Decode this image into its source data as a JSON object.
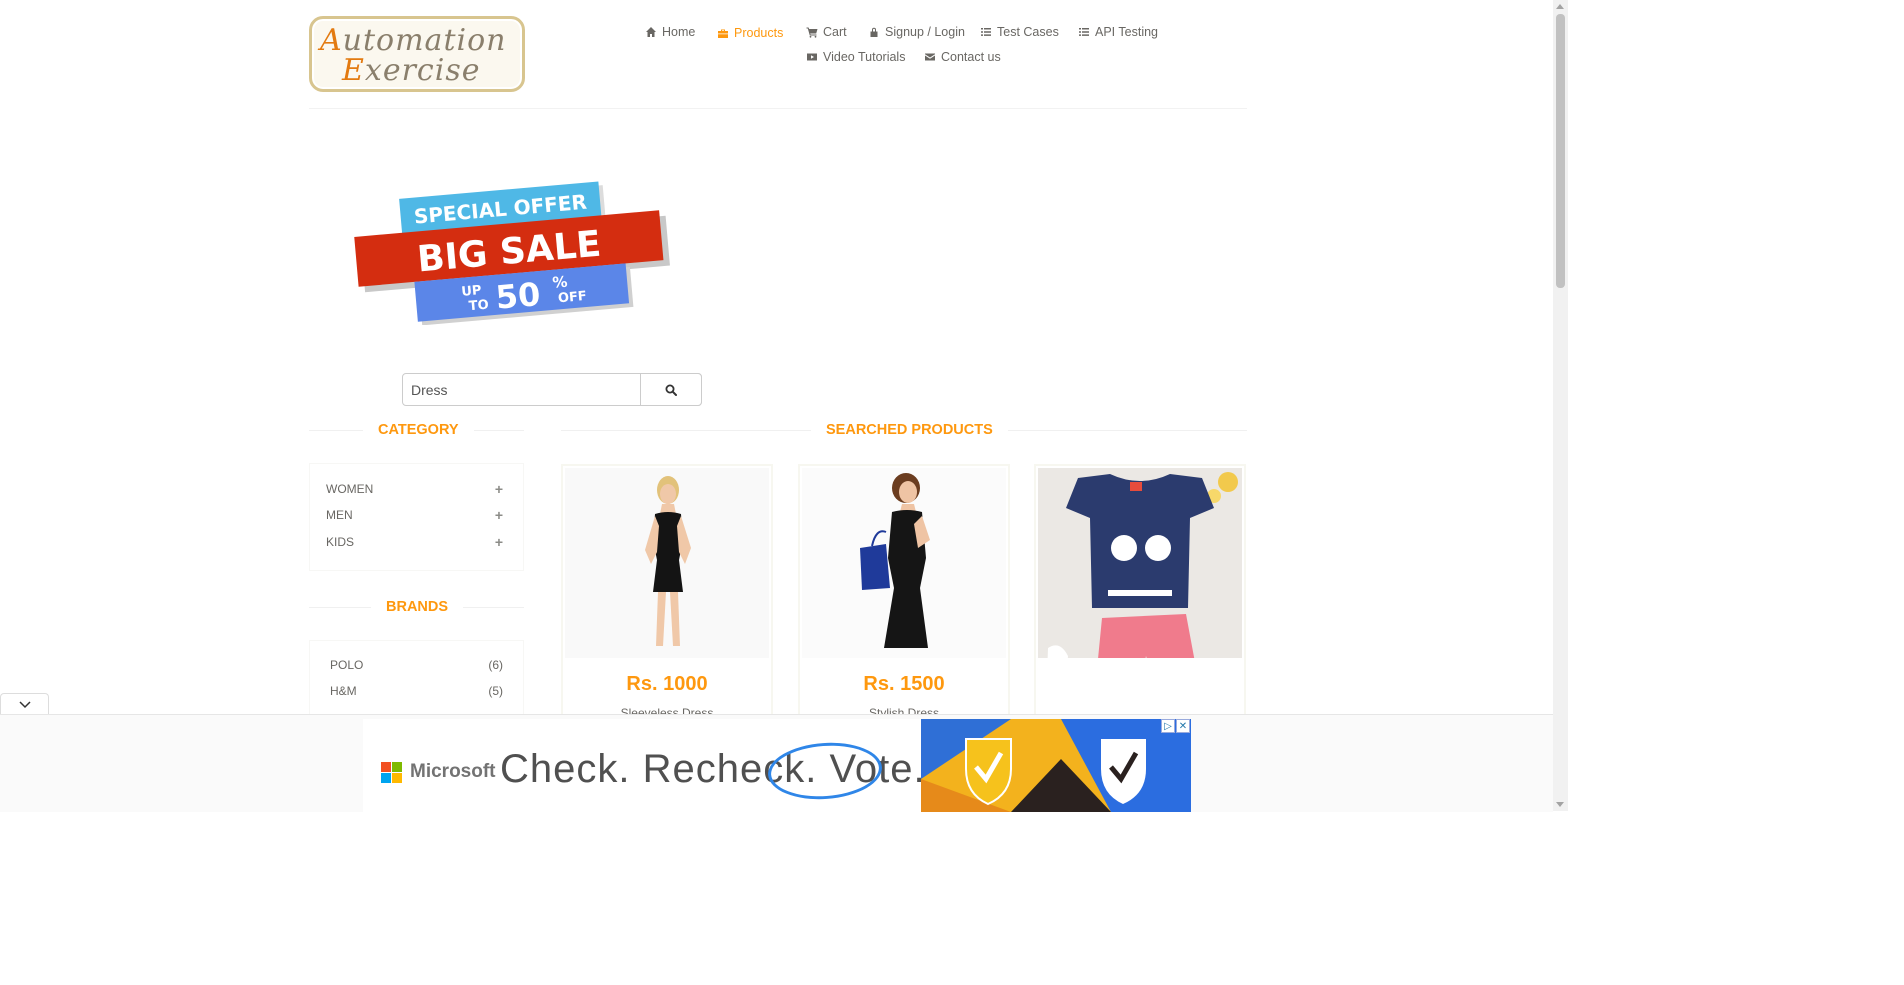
{
  "brand": {
    "logo_line1": "Automation",
    "logo_line2": "Exercise"
  },
  "nav": {
    "items": [
      {
        "label": "Home",
        "icon": "home-icon"
      },
      {
        "label": "Products",
        "icon": "products-icon",
        "active": true
      },
      {
        "label": "Cart",
        "icon": "cart-icon"
      },
      {
        "label": "Signup / Login",
        "icon": "lock-icon"
      },
      {
        "label": "Test Cases",
        "icon": "list-icon"
      },
      {
        "label": "API Testing",
        "icon": "list-icon"
      },
      {
        "label": "Video Tutorials",
        "icon": "youtube-icon"
      },
      {
        "label": "Contact us",
        "icon": "envelope-icon"
      }
    ]
  },
  "banner": {
    "line1": "SPECIAL OFFER",
    "line2": "BIG SALE",
    "up": "UP",
    "to": "TO",
    "percent": "50",
    "pct_sign": "%",
    "off": "OFF"
  },
  "search": {
    "value": "Dress",
    "button_icon": "search-icon"
  },
  "sidebar": {
    "category_title": "CATEGORY",
    "categories": [
      "WOMEN",
      "MEN",
      "KIDS"
    ],
    "brands_title": "BRANDS",
    "brands": [
      {
        "name": "POLO",
        "count": "(6)"
      },
      {
        "name": "H&M",
        "count": "(5)"
      }
    ]
  },
  "main": {
    "title": "SEARCHED PRODUCTS",
    "products": [
      {
        "price": "Rs. 1000",
        "name": "Sleeveless Dress"
      },
      {
        "price": "Rs. 1500",
        "name": "Stylish Dress"
      },
      {
        "price": "",
        "name": ""
      }
    ]
  },
  "ad": {
    "advertiser": "Microsoft",
    "slogan": "Check. Recheck. Vote.",
    "adchoices_icon": "adchoices-icon",
    "close_icon": "close-icon"
  },
  "colors": {
    "accent": "#FE980F",
    "text": "#696763",
    "sale_red": "#d42d10",
    "sale_cyan": "#4fb8e6",
    "sale_blue": "#5b86e8"
  }
}
